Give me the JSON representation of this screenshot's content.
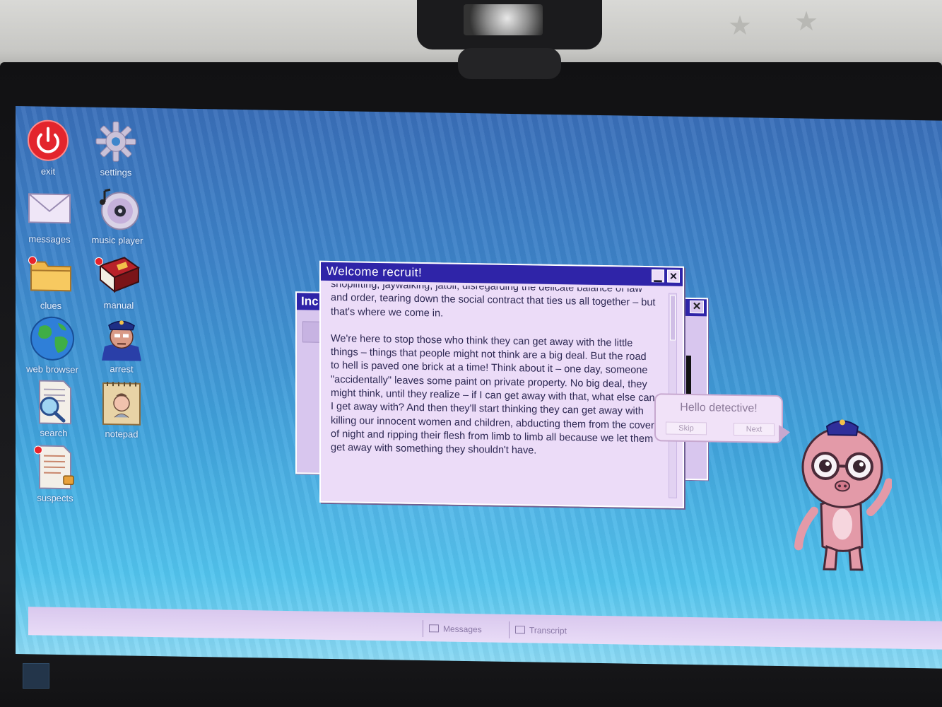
{
  "desktop": {
    "icons": [
      {
        "label": "exit"
      },
      {
        "label": "settings"
      },
      {
        "label": "messages"
      },
      {
        "label": "music player"
      },
      {
        "label": "clues"
      },
      {
        "label": "manual"
      },
      {
        "label": "web browser"
      },
      {
        "label": "arrest"
      },
      {
        "label": "search"
      },
      {
        "label": "notepad"
      },
      {
        "label": "suspects"
      }
    ]
  },
  "back_window": {
    "title": "Inc",
    "close_glyph": "✕"
  },
  "main_window": {
    "title": "Welcome recruit!",
    "minimize_glyph": "▁",
    "close_glyph": "✕",
    "paragraphs": [
      "shoplifting, jaywalking, jatoll, disregarding the delicate balance of law and order, tearing down the social contract that ties us all together – but that's where we come in.",
      "We're here to stop those who think they can get away with the little things – things that people might not think are a big deal. But the road to hell is paved one brick at a time! Think about it – one day, someone \"accidentally\" leaves some paint on private property. No big deal, they might think, until they realize – if I can get away with that, what else can I get away with? And then they'll start thinking they can get away with killing our innocent women and children, abducting them from the cover of night and ripping their flesh from limb to limb all because we let them get away with something they shouldn't have."
    ]
  },
  "bubble": {
    "text": "Hello detective!",
    "skip_label": "Skip",
    "next_label": "Next"
  },
  "taskbar": {
    "items": [
      {
        "label": "Messages"
      },
      {
        "label": "Transcript"
      }
    ]
  },
  "colors": {
    "titlebar": "#2f24a8",
    "window_bg": "#ecdcf8",
    "desktop_top": "#3a6fb9",
    "desktop_bottom": "#8bd9f4"
  }
}
